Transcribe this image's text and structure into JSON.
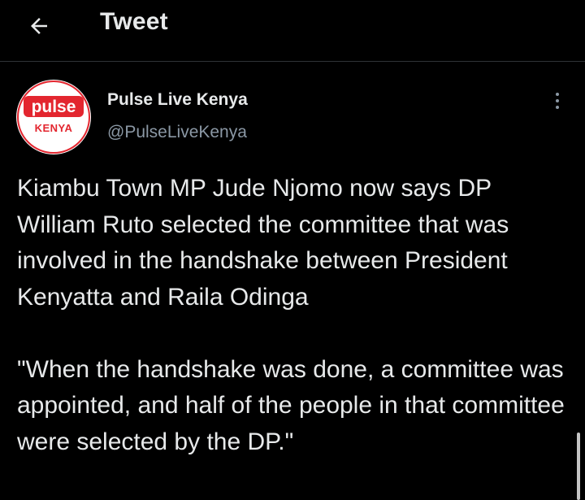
{
  "header": {
    "title": "Tweet",
    "back_icon": "arrow-left-icon"
  },
  "tweet": {
    "author": {
      "name": "Pulse Live Kenya",
      "handle": "@PulseLiveKenya",
      "avatar": {
        "logo_text": "pulse",
        "country_text": "KENYA",
        "brand_color": "#e3262f"
      }
    },
    "more_icon": "more-vertical-icon",
    "paragraphs": [
      "Kiambu Town MP Jude Njomo now says DP William Ruto selected the committee that was involved in the handshake between President Kenyatta and Raila Odinga",
      "\"When the handshake was done, a committee was appointed, and half of the people in that committee were selected by the DP.\""
    ]
  },
  "colors": {
    "background": "#000000",
    "text_primary": "#e7e9ea",
    "text_secondary": "#8b98a5",
    "divider": "#2f3336"
  }
}
